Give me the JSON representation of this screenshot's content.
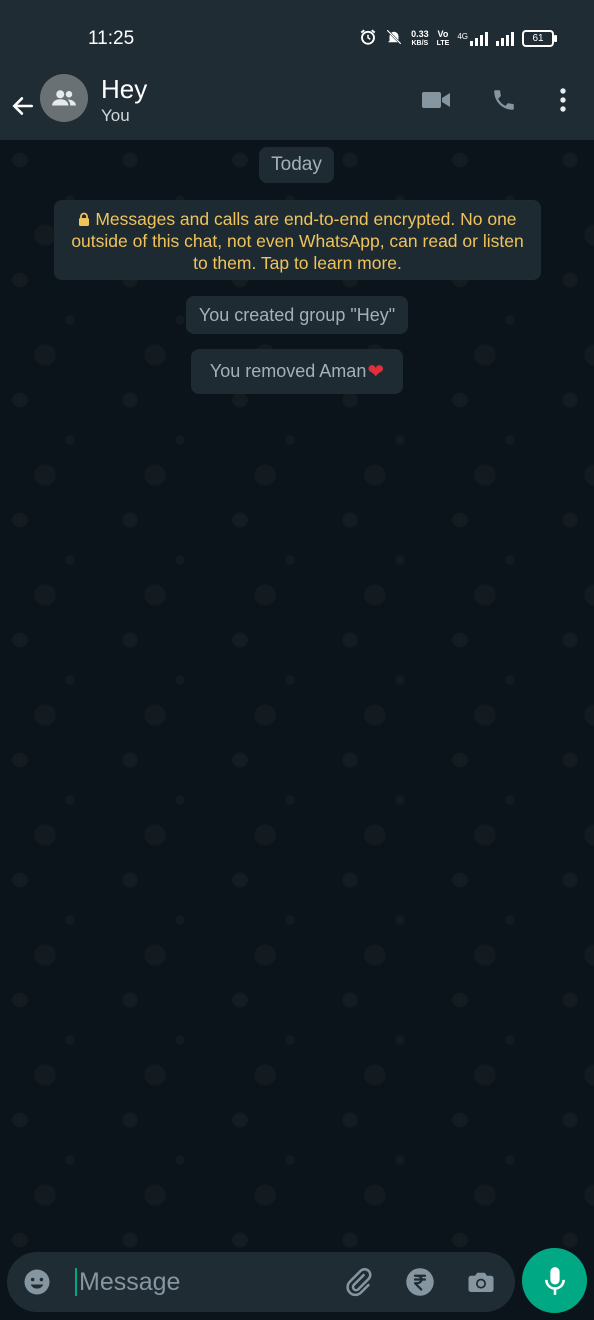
{
  "status_bar": {
    "time": "11:25",
    "data_speed": "0.33",
    "data_unit": "KB/S",
    "volte_top": "Vo",
    "volte_bottom": "LTE",
    "network": "4G",
    "battery": "61"
  },
  "header": {
    "title": "Hey",
    "subtitle": "You",
    "icons": [
      "back-arrow-icon",
      "group-avatar-icon",
      "video-call-icon",
      "phone-icon",
      "more-vert-icon"
    ]
  },
  "chat": {
    "date_chip": "Today",
    "encryption_notice": "Messages and calls are end-to-end encrypted. No one outside of this chat, not even WhatsApp, can read or listen to them. Tap to learn more.",
    "system_messages": [
      "You created group \"Hey\"",
      "You removed Aman"
    ],
    "heart": "❤"
  },
  "composer": {
    "placeholder": "Message",
    "icons": [
      "emoji-icon",
      "attach-icon",
      "rupee-icon",
      "camera-icon",
      "mic-icon"
    ]
  },
  "colors": {
    "background": "#0b141a",
    "bar": "#1f2c34",
    "accent": "#00a884",
    "encryption_text": "#f0c35b",
    "system_text": "#a5b0b7"
  }
}
